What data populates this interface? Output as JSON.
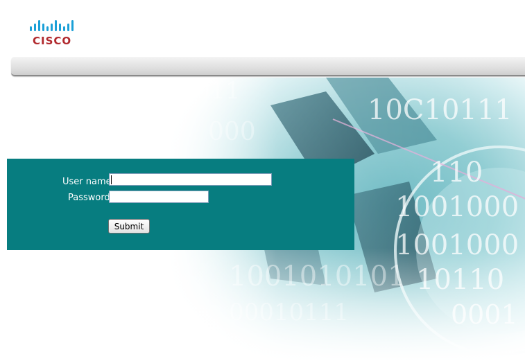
{
  "brand": {
    "logo_text": "CISCO",
    "color": "#b1292e"
  },
  "login": {
    "username_label": "User name:",
    "username_value": "",
    "password_label": "Password:",
    "password_value": "",
    "submit_label": "Submit"
  },
  "colors": {
    "panel": "#077d80",
    "bar": "#dcdcdc"
  }
}
